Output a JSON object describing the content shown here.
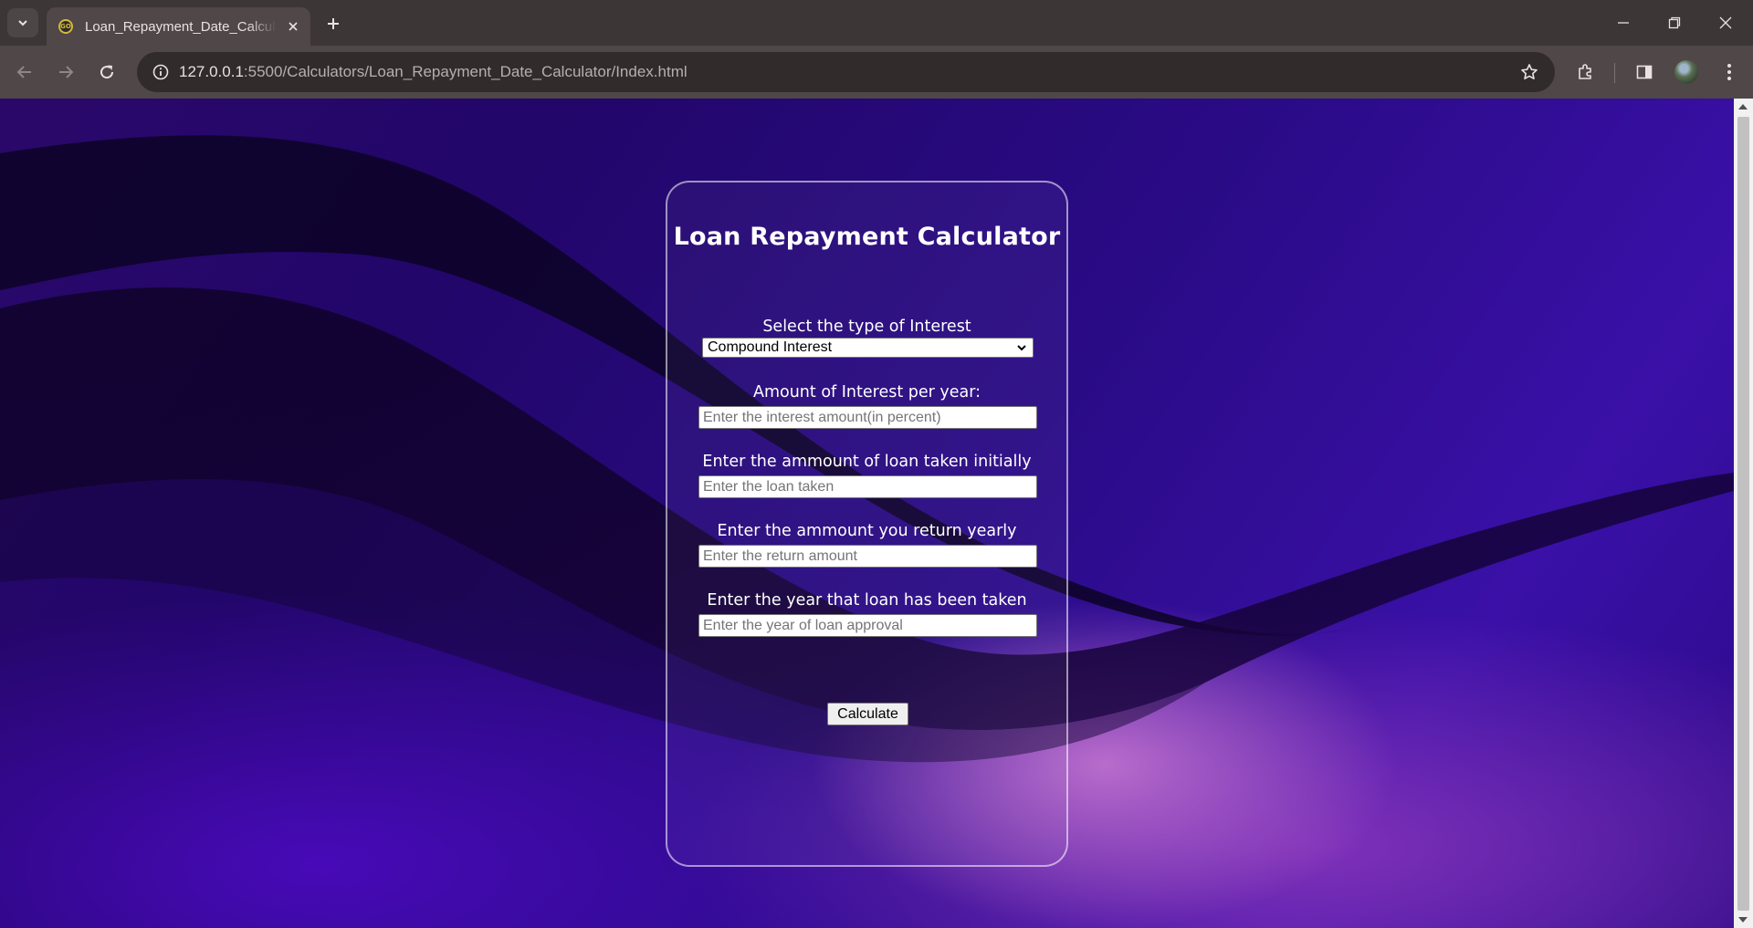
{
  "browser": {
    "tab_title": "Loan_Repayment_Date_Calculator",
    "url_host": "127.0.0.1",
    "url_path": ":5500/Calculators/Loan_Repayment_Date_Calculator/Index.html"
  },
  "card": {
    "title": "Loan Repayment Calculator",
    "interest_type": {
      "label": "Select the type of Interest",
      "selected": "Compound Interest"
    },
    "interest_rate": {
      "label": "Amount of Interest per year:",
      "placeholder": "Enter the interest amount(in percent)"
    },
    "loan_amount": {
      "label": "Enter the ammount of loan taken initially",
      "placeholder": "Enter the loan taken"
    },
    "return_amount": {
      "label": "Enter the ammount you return yearly",
      "placeholder": "Enter the return amount"
    },
    "loan_year": {
      "label": "Enter the year that loan has been taken",
      "placeholder": "Enter the year of loan approval"
    },
    "calculate_label": "Calculate"
  }
}
